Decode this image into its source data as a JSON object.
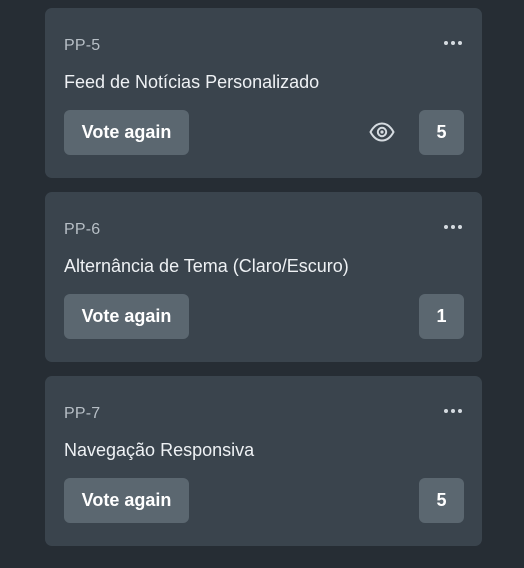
{
  "cards": [
    {
      "key": "PP-5",
      "title": "Feed de Notícias Personalizado",
      "vote_label": "Vote again",
      "count": "5",
      "show_eye": true
    },
    {
      "key": "PP-6",
      "title": "Alternância de Tema (Claro/Escuro)",
      "vote_label": "Vote again",
      "count": "1",
      "show_eye": false
    },
    {
      "key": "PP-7",
      "title": "Navegação Responsiva",
      "vote_label": "Vote again",
      "count": "5",
      "show_eye": false
    }
  ],
  "icons": {
    "more": "more-horizontal-icon",
    "eye": "eye-icon"
  },
  "colors": {
    "page_background": "#262d34",
    "card_background": "#3a444d",
    "button_background": "#5b6770",
    "text_primary": "#eef1f4",
    "text_secondary": "#b7bfc6"
  }
}
